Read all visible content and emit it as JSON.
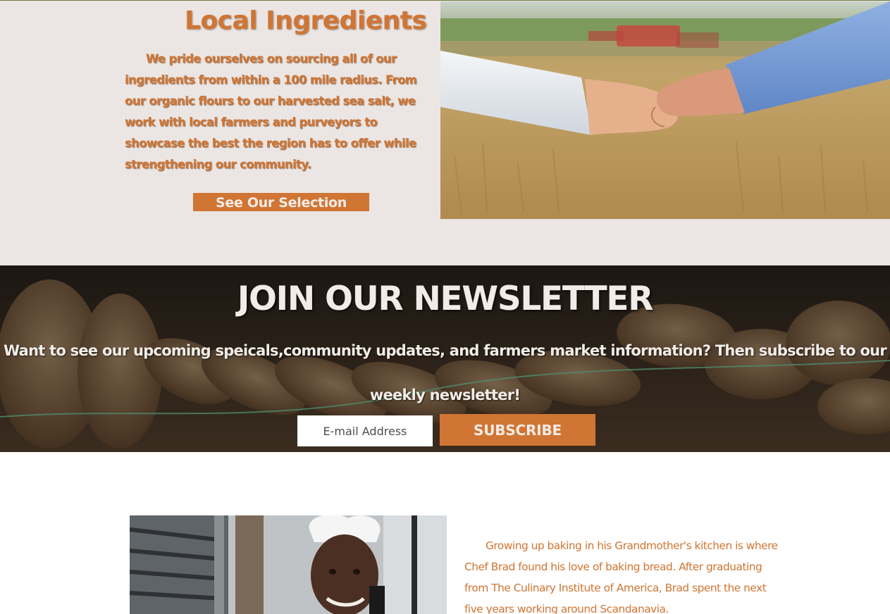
{
  "ingredients": {
    "title": "Local Ingredients",
    "body": "We pride ourselves on sourcing all of our ingredients from within a 100 mile radius. From our organic flours to our harvested sea salt, we work with local farmers and purveyors to showcase the best the region has to offer while strengthening our community.",
    "button_label": "See Our Selection",
    "photo_icon": "handshake-in-wheat-field-photo"
  },
  "newsletter": {
    "title": "JOIN OUR NEWSLETTER",
    "body": "Want to see our upcoming speicals,community updates, and farmers market information? Then subscribe to our weekly newsletter!",
    "email_placeholder": "E-mail Address",
    "email_value": "",
    "subscribe_label": "SUBSCRIBE",
    "background_icon": "bread-loaves-photo"
  },
  "chef": {
    "body": "Growing up baking in his Grandmother's kitchen is where Chef Brad found his love of baking bread. After graduating from The Culinary Institute of America, Brad spent the next five years working around Scandanavia.",
    "photo_icon": "chef-portrait-photo"
  },
  "colors": {
    "accent": "#d07533",
    "section_bg": "#ebe6e4",
    "light_text": "#f1ece8"
  }
}
